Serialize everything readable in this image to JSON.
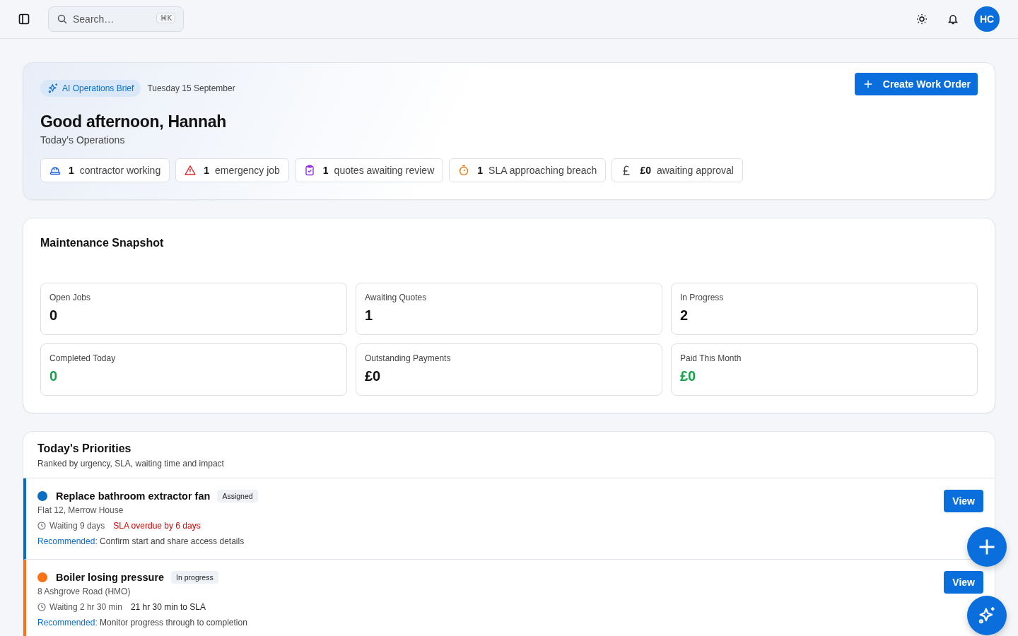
{
  "topbar": {
    "search": {
      "placeholder": "Search…",
      "shortcut": "⌘K"
    },
    "avatar": "HC"
  },
  "brief": {
    "badge": "AI Operations Brief",
    "date": "Tuesday 15 September",
    "greeting": "Good afternoon, Hannah",
    "subtitle": "Today's Operations",
    "action": "Create Work Order",
    "chips": [
      {
        "kind": "hardhat",
        "count": "1",
        "label": "contractor working"
      },
      {
        "kind": "alert",
        "count": "1",
        "label": "emergency job"
      },
      {
        "kind": "clipboard",
        "count": "1",
        "label": "quotes awaiting review"
      },
      {
        "kind": "timer",
        "count": "1",
        "label": "SLA approaching breach"
      },
      {
        "kind": "pound",
        "count": "£0",
        "label": "awaiting approval"
      }
    ]
  },
  "snapshot": {
    "title": "Maintenance Snapshot",
    "stats": [
      {
        "label": "Open Jobs",
        "value": "0",
        "color": "#111111"
      },
      {
        "label": "Awaiting Quotes",
        "value": "1",
        "color": "#111111"
      },
      {
        "label": "In Progress",
        "value": "2",
        "color": "#111111"
      },
      {
        "label": "Completed Today",
        "value": "0",
        "color": "#16a34a"
      },
      {
        "label": "Outstanding Payments",
        "value": "£0",
        "color": "#111111"
      },
      {
        "label": "Paid This Month",
        "value": "£0",
        "color": "#16a34a"
      }
    ]
  },
  "priorities": {
    "title": "Today's Priorities",
    "subtitle": "Ranked by urgency, SLA, waiting time and impact",
    "items": [
      {
        "title": "Replace bathroom extractor fan",
        "status": "Assigned",
        "color": "#0a6fc2",
        "location": "Flat 12, Merrow House",
        "waiting": "Waiting 9 days",
        "sla": "SLA overdue by 6 days",
        "sla_overdue": true,
        "recommendation_label": "Recommended:",
        "recommendation": "Confirm start and share access details",
        "action": "View"
      },
      {
        "title": "Boiler losing pressure",
        "status": "In progress",
        "color": "#f97316",
        "location": "8 Ashgrove Road (HMO)",
        "waiting": "Waiting 2 hr 30 min",
        "sla": "21 hr 30 min to SLA",
        "sla_overdue": false,
        "recommendation_label": "Recommended:",
        "recommendation": "Monitor progress through to completion",
        "action": "View"
      }
    ]
  }
}
